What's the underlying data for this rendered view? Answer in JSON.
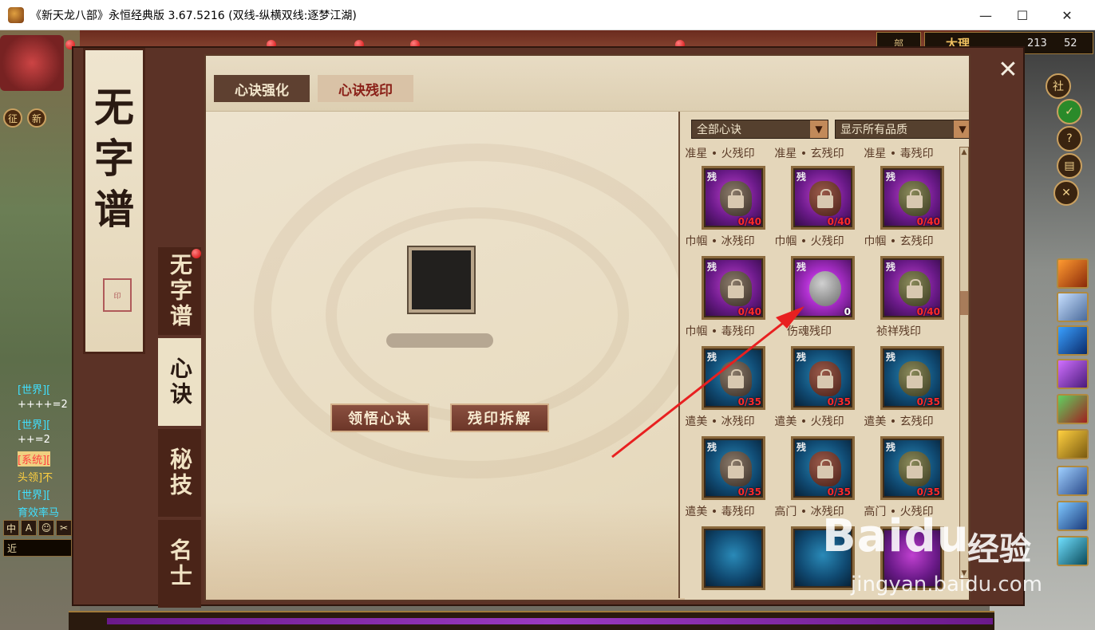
{
  "window": {
    "title": "《新天龙八部》永恒经典版 3.67.5216 (双线-纵横双线:逐梦江湖)",
    "minimize": "—",
    "maximize": "☐",
    "close": "✕"
  },
  "hud": {
    "btn_zheng": "征",
    "btn_xin": "新",
    "badge": "部",
    "location": "大理",
    "coord_x": "213",
    "coord_y": "52",
    "she_btn": "社",
    "help_btn": "?"
  },
  "chat": {
    "lines": [
      "[世界][",
      "++++=2",
      "[世界][",
      "++=2",
      "[系统][",
      "头领]不",
      "[世界][",
      "育效率马"
    ],
    "tools": [
      "中",
      "A",
      "☺",
      "✂"
    ],
    "input_prefix": "近"
  },
  "dialog": {
    "close": "✕",
    "banner_title": "无字谱",
    "seal_text": "印",
    "side_tabs": [
      "无字谱",
      "心诀",
      "秘技",
      "名士"
    ],
    "active_side_tab": 1,
    "top_tabs": [
      "心诀强化",
      "心诀残印"
    ],
    "actions": {
      "comprehend": "领悟心诀",
      "dismantle": "残印拆解"
    },
    "filters": {
      "category": "全部心诀",
      "quality": "显示所有品质"
    },
    "grid": {
      "top_labels": [
        "准星 • 火残印",
        "准星 • 玄残印",
        "准星 • 毒残印"
      ],
      "rows": [
        [
          {
            "label": "巾帼 • 冰残印",
            "count": "0/40",
            "style": "purple",
            "mark": "残"
          },
          {
            "label": "巾帼 • 火残印",
            "count": "0/40",
            "style": "purple",
            "mark": "残"
          },
          {
            "label": "巾帼 • 玄残印",
            "count": "0/40",
            "style": "purple",
            "mark": "残"
          }
        ],
        [
          {
            "label": "巾帼 • 毒残印",
            "count": "0/40",
            "style": "purple",
            "mark": "残"
          },
          {
            "label": "伤魂残印",
            "count": "0",
            "style": "glow",
            "mark": "残"
          },
          {
            "label": "祯祥残印",
            "count": "0/40",
            "style": "purple",
            "mark": "残"
          }
        ],
        [
          {
            "label": "遣美 • 冰残印",
            "count": "0/35",
            "style": "blue",
            "mark": "残"
          },
          {
            "label": "遣美 • 火残印",
            "count": "0/35",
            "style": "blue",
            "mark": "残"
          },
          {
            "label": "遣美 • 玄残印",
            "count": "0/35",
            "style": "blue",
            "mark": "残"
          }
        ],
        [
          {
            "label": "遣美 • 毒残印",
            "count": "0/35",
            "style": "blue",
            "mark": "残"
          },
          {
            "label": "高门 • 冰残印",
            "count": "0/35",
            "style": "blue",
            "mark": "残"
          },
          {
            "label": "高门 • 火残印",
            "count": "0/35",
            "style": "blue",
            "mark": "残"
          }
        ]
      ]
    }
  },
  "watermark": {
    "logo": "Baidu",
    "cn": "经验",
    "url": "jingyan.baidu.com"
  }
}
